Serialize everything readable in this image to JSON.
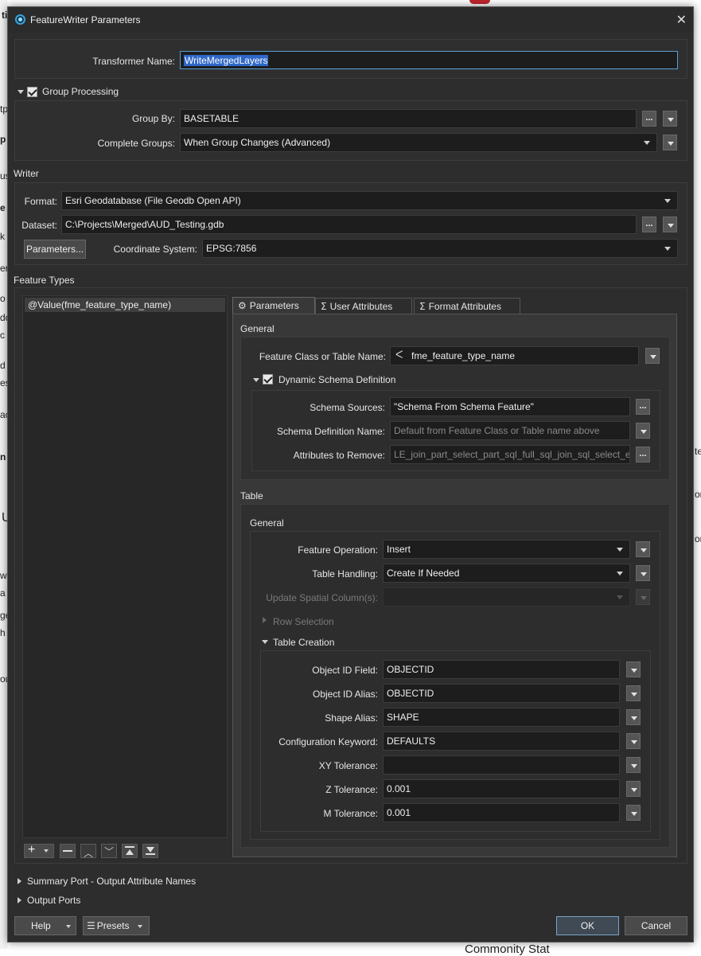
{
  "background": {
    "fragments": [
      "ti",
      "tp",
      "p",
      "us",
      "e",
      "k",
      "er",
      "o",
      "dc",
      "c",
      "d",
      "es",
      "ac",
      "n",
      "U",
      "w",
      "a",
      "ge",
      "h",
      "ou",
      "te",
      "or",
      "or",
      "Commonity Stat"
    ]
  },
  "dialog": {
    "title": "FeatureWriter Parameters",
    "transformer_name_label": "Transformer Name:",
    "transformer_name_value": "WriteMergedLayers",
    "group_processing": {
      "label": "Group Processing",
      "checked": true,
      "group_by_label": "Group By:",
      "group_by_value": "BASETABLE",
      "complete_groups_label": "Complete Groups:",
      "complete_groups_value": "When Group Changes (Advanced)"
    },
    "writer": {
      "section_label": "Writer",
      "format_label": "Format:",
      "format_value": "Esri Geodatabase (File Geodb Open API)",
      "dataset_label": "Dataset:",
      "dataset_value": "C:\\Projects\\Merged\\AUD_Testing.gdb",
      "parameters_button": "Parameters...",
      "coord_label": "Coordinate System:",
      "coord_value": "EPSG:7856"
    },
    "feature_types": {
      "section_label": "Feature Types",
      "items": [
        "@Value(fme_feature_type_name)"
      ]
    },
    "tabs": [
      "Parameters",
      "User Attributes",
      "Format Attributes"
    ],
    "params": {
      "general_label": "General",
      "feature_class_label": "Feature Class or Table Name:",
      "feature_class_value": "fme_feature_type_name",
      "dynamic_schema_label": "Dynamic Schema Definition",
      "schema_sources_label": "Schema Sources:",
      "schema_sources_value": "\"Schema From Schema Feature\"",
      "schema_def_name_label": "Schema Definition Name:",
      "schema_def_name_placeholder": "Default from Feature Class or Table name above",
      "attrs_remove_label": "Attributes to Remove:",
      "attrs_remove_value": "LE_join_part_select_part_sql_full_sql_join_sql_select_ext",
      "table_label": "Table",
      "table_general_label": "General",
      "feature_operation_label": "Feature Operation:",
      "feature_operation_value": "Insert",
      "table_handling_label": "Table Handling:",
      "table_handling_value": "Create If Needed",
      "update_spatial_label": "Update Spatial Column(s):",
      "row_selection_label": "Row Selection",
      "table_creation_label": "Table Creation",
      "object_id_field_label": "Object ID Field:",
      "object_id_field_value": "OBJECTID",
      "object_id_alias_label": "Object ID Alias:",
      "object_id_alias_value": "OBJECTID",
      "shape_alias_label": "Shape Alias:",
      "shape_alias_value": "SHAPE",
      "config_keyword_label": "Configuration Keyword:",
      "config_keyword_value": "DEFAULTS",
      "xy_tol_label": "XY Tolerance:",
      "xy_tol_value": "",
      "z_tol_label": "Z Tolerance:",
      "z_tol_value": "0.001",
      "m_tol_label": "M Tolerance:",
      "m_tol_value": "0.001"
    },
    "summary_port_label": "Summary Port - Output Attribute Names",
    "output_ports_label": "Output Ports",
    "help_button": "Help",
    "presets_button": "Presets",
    "ok_button": "OK",
    "cancel_button": "Cancel"
  }
}
